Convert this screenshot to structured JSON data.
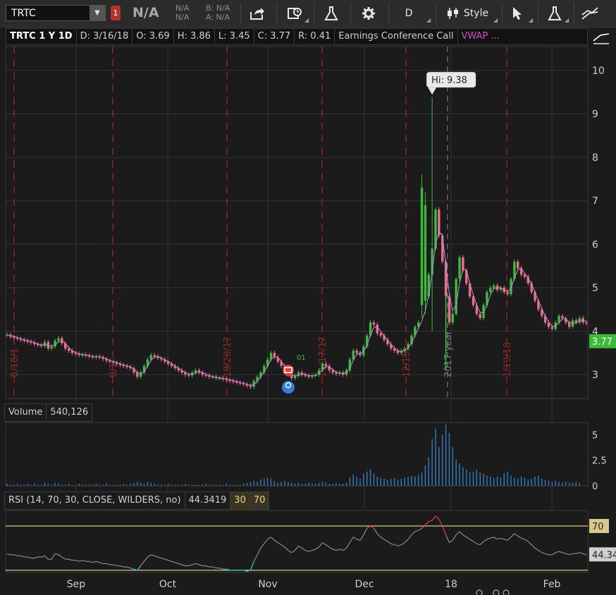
{
  "toolbar": {
    "symbol": "TRTC",
    "alert_count": "1",
    "last_price": "N/A",
    "change_top": "N/A",
    "change_bottom": "N/A",
    "bid": "B: N/A",
    "ask": "A: N/A",
    "aggregation": "D",
    "style_label": "Style"
  },
  "status": {
    "title": "TRTC 1 Y 1D",
    "date": "D: 3/16/18",
    "open": "O: 3.69",
    "high": "H: 3.86",
    "low": "L: 3.45",
    "close": "C: 3.77",
    "range": "R: 0.41",
    "study": "Earnings Conference Call",
    "vwap": "VWAP ..."
  },
  "volume_panel": {
    "label": "Volume",
    "value": "540,126"
  },
  "rsi_panel": {
    "label": "RSI (14, 70, 30, CLOSE, WILDERS, no)",
    "value": "44.3419",
    "oversold": "30",
    "overbought": "70"
  },
  "colors": {
    "up": "#3cba3c",
    "down": "#f06a8a",
    "grid": "#333333",
    "event_line": "#c0282a",
    "rsi_line": "#8a8a8a",
    "rsi_hot": "#e0443a",
    "rsi_cold": "#2ad1c8",
    "price_bubble": "#3cba3c",
    "volume_bar": "#2f7fbf"
  },
  "chart_data": [
    {
      "type": "candlestick",
      "title": "TRTC 1 Y 1D",
      "ylim": [
        2.45,
        10.55
      ],
      "y_ticks": [
        3,
        4,
        5,
        6,
        7,
        8,
        9,
        10
      ],
      "x_labels": [
        "Sep",
        "Oct",
        "Nov",
        "Dec",
        "18",
        "Feb"
      ],
      "last_price": "3.77",
      "high_label": "Hi: 9.38",
      "event_labels": [
        "8/18/1",
        "9/1",
        "10/20/17",
        "11/17/17",
        "12/15/",
        "2017 year",
        "1/19/18"
      ],
      "annotation": "01",
      "close": [
        3.92,
        3.87,
        3.85,
        3.83,
        3.8,
        3.78,
        3.76,
        3.74,
        3.7,
        3.68,
        3.66,
        3.75,
        3.6,
        3.65,
        3.78,
        3.84,
        3.72,
        3.6,
        3.55,
        3.5,
        3.48,
        3.45,
        3.46,
        3.44,
        3.42,
        3.4,
        3.42,
        3.4,
        3.36,
        3.32,
        3.3,
        3.28,
        3.25,
        3.22,
        3.2,
        3.18,
        3.15,
        3.05,
        2.95,
        3.05,
        3.2,
        3.35,
        3.45,
        3.42,
        3.38,
        3.35,
        3.3,
        3.25,
        3.2,
        3.15,
        3.1,
        3.05,
        3.0,
        2.98,
        3.05,
        3.1,
        3.05,
        3.0,
        2.98,
        2.95,
        2.95,
        2.92,
        2.92,
        2.9,
        2.88,
        2.86,
        2.84,
        2.82,
        2.8,
        2.78,
        2.75,
        2.72,
        2.85,
        2.95,
        3.05,
        3.2,
        3.35,
        3.5,
        3.4,
        3.3,
        3.2,
        3.1,
        3.0,
        2.92,
        2.98,
        3.05,
        3.0,
        2.98,
        2.95,
        2.98,
        3.0,
        3.1,
        3.25,
        3.2,
        3.1,
        3.05,
        3.02,
        3.05,
        3.0,
        3.1,
        3.35,
        3.55,
        3.5,
        3.45,
        3.65,
        3.9,
        4.2,
        4.15,
        3.95,
        3.9,
        3.8,
        3.7,
        3.6,
        3.55,
        3.5,
        3.55,
        3.6,
        3.7,
        3.9,
        4.1,
        4.2,
        4.4,
        4.8,
        5.3,
        5.9,
        6.8,
        6.2,
        5.6,
        4.8,
        4.2,
        4.4,
        5.2,
        5.7,
        5.4,
        5.1,
        4.8,
        4.6,
        4.4,
        4.3,
        4.6,
        4.9,
        5.0,
        5.05,
        4.95,
        5.0,
        4.9,
        4.85,
        5.2,
        5.6,
        5.45,
        5.3,
        5.25,
        5.1,
        4.9,
        4.7,
        4.5,
        4.35,
        4.2,
        4.1,
        4.05,
        4.2,
        4.35,
        4.3,
        4.2,
        4.1,
        4.25,
        4.2,
        4.3,
        4.2,
        4.18
      ],
      "high_index": 124,
      "high_value": 9.38,
      "big_up": [
        {
          "i": 121,
          "low": 4.3,
          "high": 7.6
        },
        {
          "i": 122,
          "low": 4.4,
          "high": 7.2
        }
      ]
    },
    {
      "type": "bar",
      "title": "Volume",
      "ylim": [
        0,
        6.2
      ],
      "y_ticks": [
        0,
        2.5,
        5
      ],
      "values": [
        0.2,
        0.1,
        0.1,
        0.2,
        0.1,
        0.1,
        0.2,
        0.1,
        0.2,
        0.1,
        0.1,
        0.3,
        0.2,
        0.1,
        0.3,
        0.2,
        0.1,
        0.1,
        0.2,
        0.1,
        0.1,
        0.2,
        0.1,
        0.1,
        0.1,
        0.1,
        0.2,
        0.1,
        0.1,
        0.2,
        0.1,
        0.1,
        0.1,
        0.1,
        0.2,
        0.1,
        0.2,
        0.3,
        0.4,
        0.3,
        0.2,
        0.4,
        0.3,
        0.2,
        0.1,
        0.1,
        0.1,
        0.2,
        0.1,
        0.1,
        0.1,
        0.1,
        0.2,
        0.1,
        0.1,
        0.1,
        0.1,
        0.1,
        0.2,
        0.1,
        0.1,
        0.1,
        0.1,
        0.1,
        0.2,
        0.1,
        0.1,
        0.1,
        0.1,
        0.2,
        0.3,
        0.4,
        0.5,
        0.4,
        0.6,
        0.7,
        0.8,
        0.7,
        0.5,
        0.3,
        0.4,
        0.5,
        0.4,
        0.3,
        0.2,
        0.3,
        0.2,
        0.2,
        0.3,
        0.2,
        0.2,
        0.3,
        0.4,
        0.3,
        0.2,
        0.2,
        0.3,
        0.2,
        0.2,
        0.3,
        0.8,
        1.1,
        0.9,
        0.7,
        1.2,
        1.4,
        1.6,
        1.2,
        0.9,
        0.8,
        0.7,
        0.6,
        0.7,
        0.8,
        0.6,
        0.7,
        0.8,
        0.9,
        1.0,
        0.9,
        1.1,
        1.3,
        2.0,
        2.8,
        4.6,
        5.6,
        3.8,
        5.0,
        6.0,
        5.2,
        3.8,
        2.6,
        2.2,
        1.8,
        1.6,
        1.3,
        1.4,
        1.6,
        1.3,
        1.2,
        1.0,
        0.9,
        0.8,
        0.9,
        0.8,
        1.2,
        1.4,
        1.0,
        0.8,
        0.7,
        0.9,
        0.8,
        0.6,
        0.7,
        0.9,
        1.0,
        0.7,
        0.6,
        0.5,
        0.4,
        0.5,
        0.4,
        0.3,
        0.4,
        0.3,
        0.3,
        0.4,
        0.3
      ]
    },
    {
      "type": "line",
      "title": "RSI (14, 70, 30, CLOSE, WILDERS, no)",
      "ylim": [
        28,
        84
      ],
      "levels": [
        70,
        30
      ],
      "last_value": "44.34",
      "values": [
        45,
        44,
        44,
        43,
        43,
        42,
        42,
        41,
        41,
        42,
        42,
        43,
        40,
        40,
        45,
        44,
        42,
        40,
        40,
        39,
        39,
        38,
        39,
        38,
        38,
        37,
        38,
        37,
        36,
        36,
        35,
        35,
        34,
        34,
        33,
        33,
        32,
        31,
        30,
        34,
        38,
        42,
        44,
        43,
        42,
        41,
        40,
        39,
        38,
        37,
        36,
        35,
        34,
        34,
        35,
        36,
        35,
        34,
        34,
        33,
        33,
        32,
        32,
        31,
        31,
        30,
        30,
        30,
        30,
        30,
        29,
        30,
        38,
        44,
        50,
        54,
        58,
        60,
        57,
        55,
        53,
        51,
        48,
        46,
        48,
        52,
        50,
        48,
        47,
        48,
        49,
        51,
        55,
        53,
        51,
        49,
        48,
        49,
        48,
        50,
        55,
        60,
        58,
        57,
        62,
        68,
        70,
        68,
        63,
        60,
        58,
        56,
        54,
        53,
        52,
        53,
        55,
        58,
        62,
        65,
        66,
        68,
        71,
        74,
        75,
        79,
        76,
        70,
        62,
        55,
        57,
        62,
        65,
        62,
        60,
        58,
        56,
        54,
        53,
        56,
        58,
        59,
        60,
        58,
        59,
        58,
        57,
        60,
        63,
        61,
        59,
        58,
        56,
        53,
        50,
        48,
        46,
        45,
        44,
        44,
        46,
        47,
        46,
        45,
        44,
        45,
        45,
        46,
        45,
        44
      ]
    }
  ]
}
